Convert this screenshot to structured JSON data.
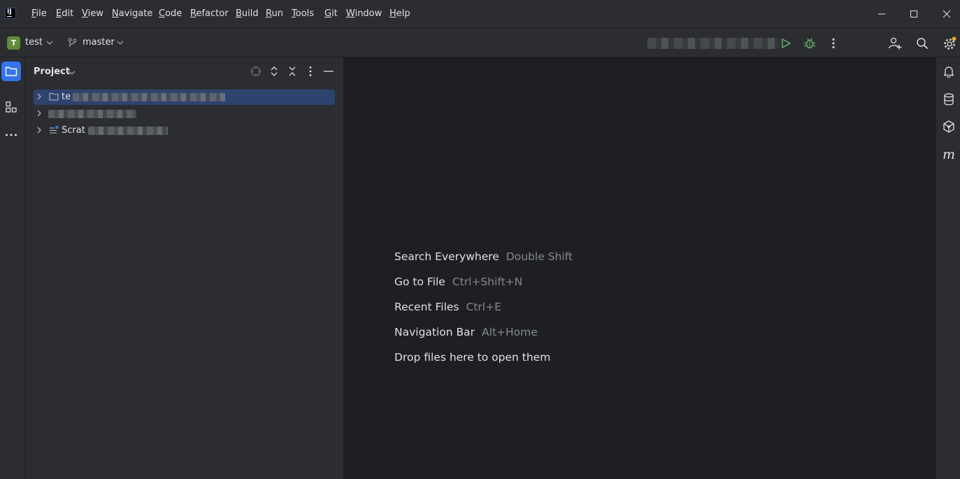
{
  "app": {
    "logo_text": "IJ"
  },
  "menu": [
    "File",
    "Edit",
    "View",
    "Navigate",
    "Code",
    "Refactor",
    "Build",
    "Run",
    "Tools",
    "Git",
    "Window",
    "Help"
  ],
  "toolbar": {
    "project_badge": "T",
    "project_name": "test",
    "branch_name": "master"
  },
  "project_panel": {
    "title": "Project",
    "tree": [
      {
        "label": "te",
        "icon": "folder-icon",
        "selected": true
      },
      {
        "label": "",
        "icon": "",
        "selected": false
      },
      {
        "label": "Scrat",
        "icon": "scratches-icon",
        "selected": false
      }
    ]
  },
  "editor": {
    "hints": [
      {
        "label": "Search Everywhere",
        "shortcut": "Double Shift"
      },
      {
        "label": "Go to File",
        "shortcut": "Ctrl+Shift+N"
      },
      {
        "label": "Recent Files",
        "shortcut": "Ctrl+E"
      },
      {
        "label": "Navigation Bar",
        "shortcut": "Alt+Home"
      },
      {
        "label": "Drop files here to open them",
        "shortcut": ""
      }
    ]
  },
  "colors": {
    "accent": "#3574f0",
    "run_green": "#5fb865",
    "badge_green": "#5f8a3b",
    "selection": "#2e436e",
    "settings_dot": "#e5a03a"
  }
}
